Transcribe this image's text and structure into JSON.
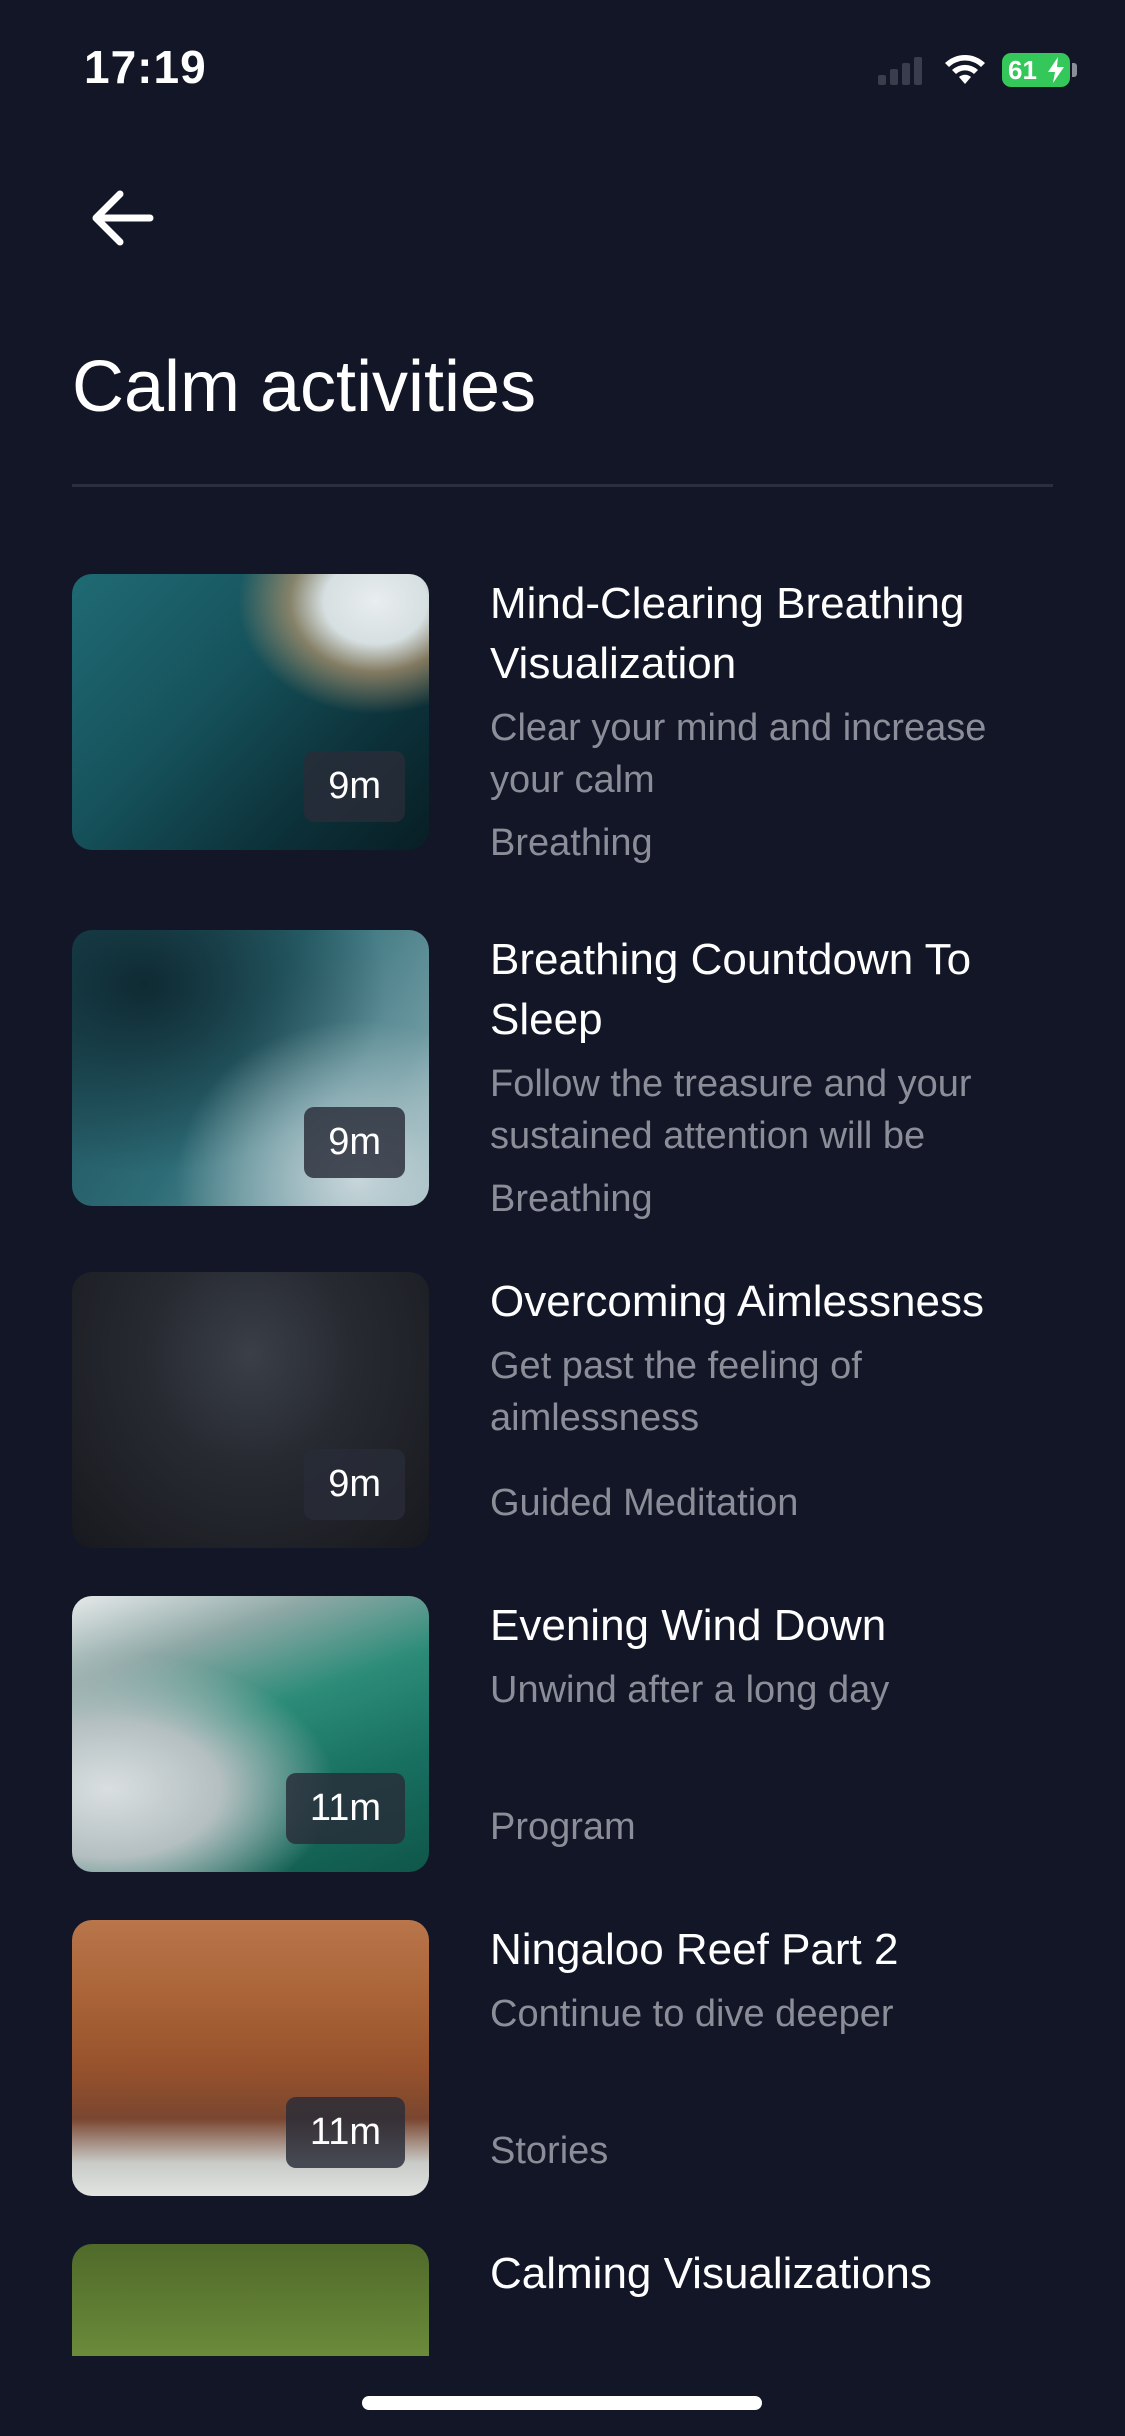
{
  "status_bar": {
    "time": "17:19",
    "battery": "61"
  },
  "header": {
    "back_icon": "arrow-left-icon",
    "title": "Calm activities"
  },
  "activities": [
    {
      "title": "Mind-Clearing Breathing Visualization",
      "description": "Clear your mind and increase your calm",
      "category": "Breathing",
      "duration": "9m"
    },
    {
      "title": "Breathing Countdown To Sleep",
      "description": "Follow the treasure and your sustained attention will be",
      "category": "Breathing",
      "duration": "9m"
    },
    {
      "title": "Overcoming Aimlessness",
      "description": "Get past the feeling of aimlessness",
      "category": "Guided Meditation",
      "duration": "9m"
    },
    {
      "title": "Evening Wind Down",
      "description": "Unwind after a long day",
      "category": "Program",
      "duration": "11m"
    },
    {
      "title": "Ningaloo Reef Part 2",
      "description": "Continue to dive deeper",
      "category": "Stories",
      "duration": "11m"
    },
    {
      "title": "Calming Visualizations",
      "description": "",
      "category": "",
      "duration": ""
    }
  ],
  "colors": {
    "background": "#121626",
    "text_primary": "#ffffff",
    "text_secondary": "#8b8e98",
    "battery": "#34c759"
  }
}
